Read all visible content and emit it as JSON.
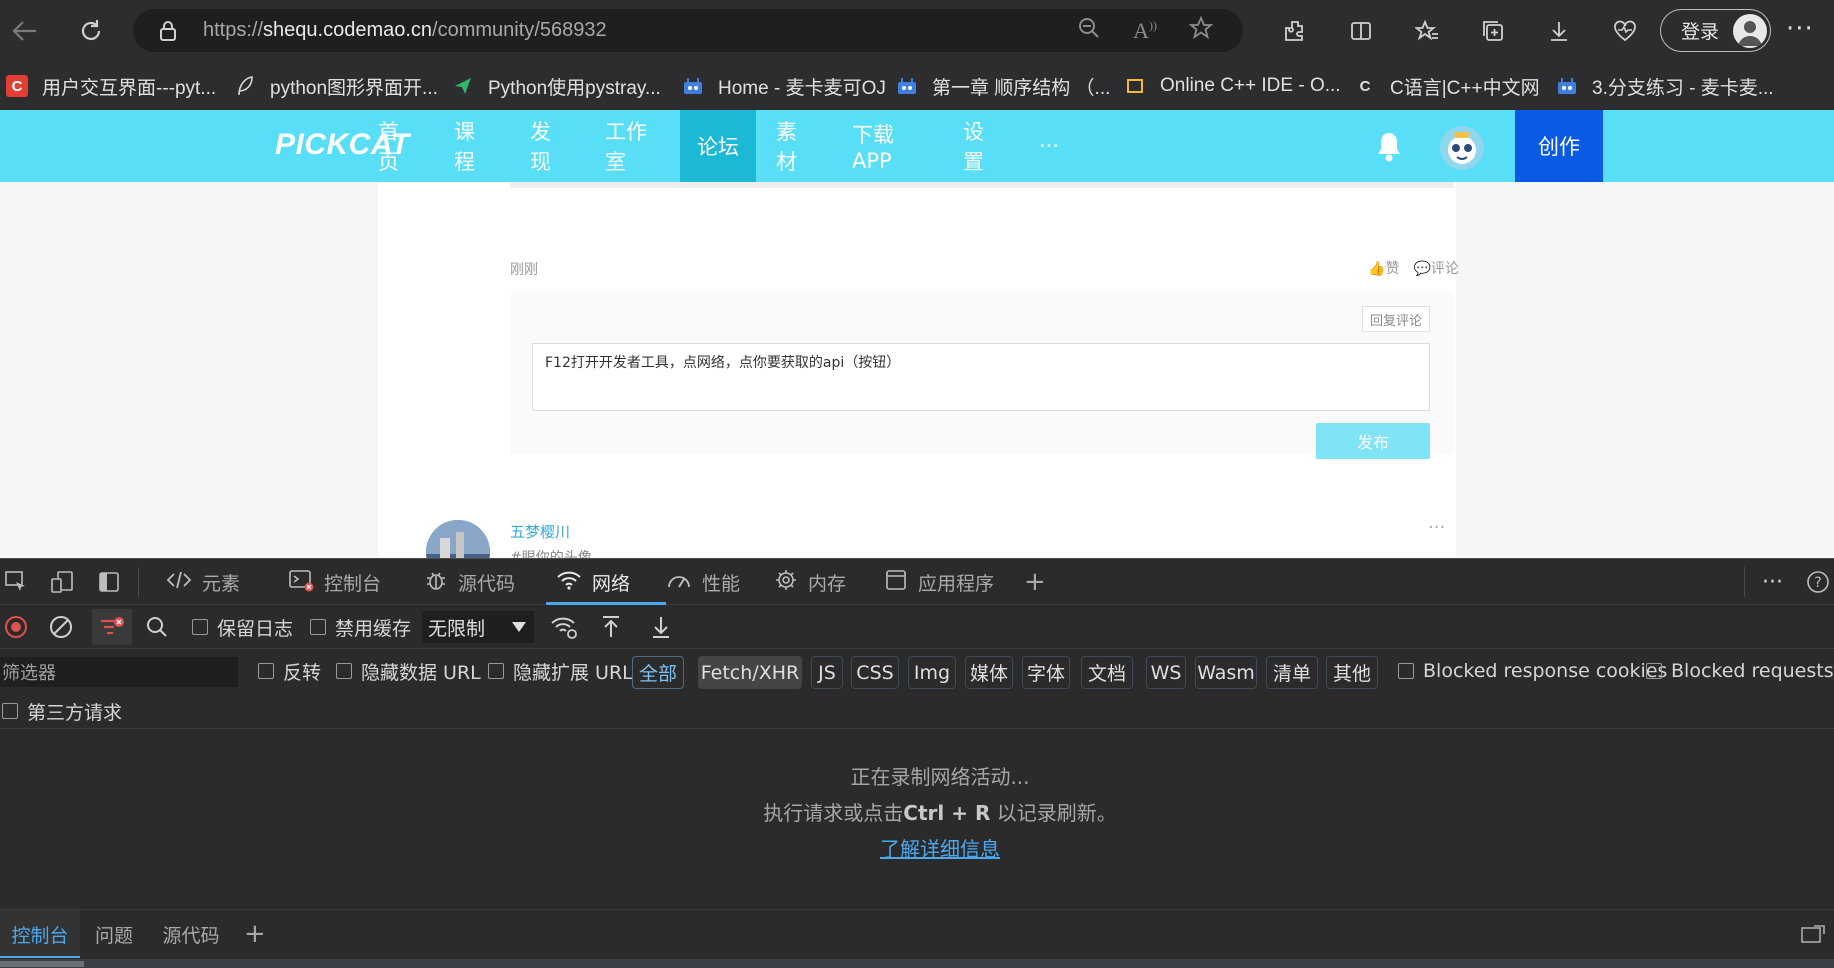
{
  "browser": {
    "url_prefix": "https://",
    "url_host": "shequ.codemao.cn",
    "url_path": "/community/568932",
    "login_label": "登录",
    "more": "···"
  },
  "bookmarks": [
    {
      "label": "用户交互界面---pyt...",
      "icon": "csdn-icon",
      "color": "#e33e33"
    },
    {
      "label": "python图形界面开...",
      "icon": "feather-icon",
      "color": "#2d2d30"
    },
    {
      "label": "Python使用pystray...",
      "icon": "send-icon",
      "color": "#2d2d30"
    },
    {
      "label": "Home - 麦卡麦可OJ",
      "icon": "robot-icon",
      "color": "#2d2d30"
    },
    {
      "label": "第一章 顺序结构 （...",
      "icon": "robot-icon",
      "color": "#2d2d30"
    },
    {
      "label": "Online C++ IDE - O...",
      "icon": "ide-icon",
      "color": "#2d2d30"
    },
    {
      "label": "C语言|C++中文网",
      "icon": "c-icon",
      "color": "#2d2d30"
    },
    {
      "label": "3.分支练习 - 麦卡麦...",
      "icon": "robot-icon",
      "color": "#2d2d30"
    }
  ],
  "site": {
    "logo": "PICKCAT",
    "menu": [
      "首页",
      "课程",
      "发现",
      "工作室",
      "论坛",
      "素材",
      "下载APP",
      "设置",
      "···"
    ],
    "active_menu": "论坛",
    "create_label": "创作",
    "accent": "#58def7"
  },
  "comment": {
    "time": "刚刚",
    "like_label": "赞",
    "comment_label": "评论",
    "reply_link": "回复评论",
    "reply_text": "F12打开开发者工具，点网络，点你要获取的api（按钮）",
    "publish_label": "发布",
    "next_user": "五梦樱川",
    "next_more": "···",
    "next_snippet": "#眼你的头像..."
  },
  "devtools": {
    "tabs": [
      {
        "label": "元素",
        "icon": "code-icon"
      },
      {
        "label": "控制台",
        "icon": "console-icon"
      },
      {
        "label": "源代码",
        "icon": "bug-icon"
      },
      {
        "label": "网络",
        "icon": "wifi-icon"
      },
      {
        "label": "性能",
        "icon": "gauge-icon"
      },
      {
        "label": "内存",
        "icon": "chip-icon"
      },
      {
        "label": "应用程序",
        "icon": "app-icon"
      }
    ],
    "active_tab": "网络",
    "toolbar": {
      "preserve_log": "保留日志",
      "disable_cache": "禁用缓存",
      "throttle": "无限制"
    },
    "filter": {
      "placeholder": "筛选器",
      "invert": "反转",
      "hide_data_url": "隐藏数据 URL",
      "hide_ext_url": "隐藏扩展 URL",
      "types": [
        "全部",
        "Fetch/XHR",
        "JS",
        "CSS",
        "Img",
        "媒体",
        "字体",
        "文档",
        "WS",
        "Wasm",
        "清单",
        "其他"
      ],
      "selected_type": "Fetch/XHR",
      "blocked_cookies": "Blocked response cookies",
      "blocked_requests": "Blocked requests",
      "third_party": "第三方请求"
    },
    "empty": {
      "line1": "正在录制网络活动...",
      "line2_a": "执行请求或点击",
      "line2_key": "Ctrl + R",
      "line2_b": "以记录刷新。",
      "link": "了解详细信息"
    },
    "drawer": [
      "控制台",
      "问题",
      "源代码"
    ],
    "drawer_active": "控制台"
  }
}
